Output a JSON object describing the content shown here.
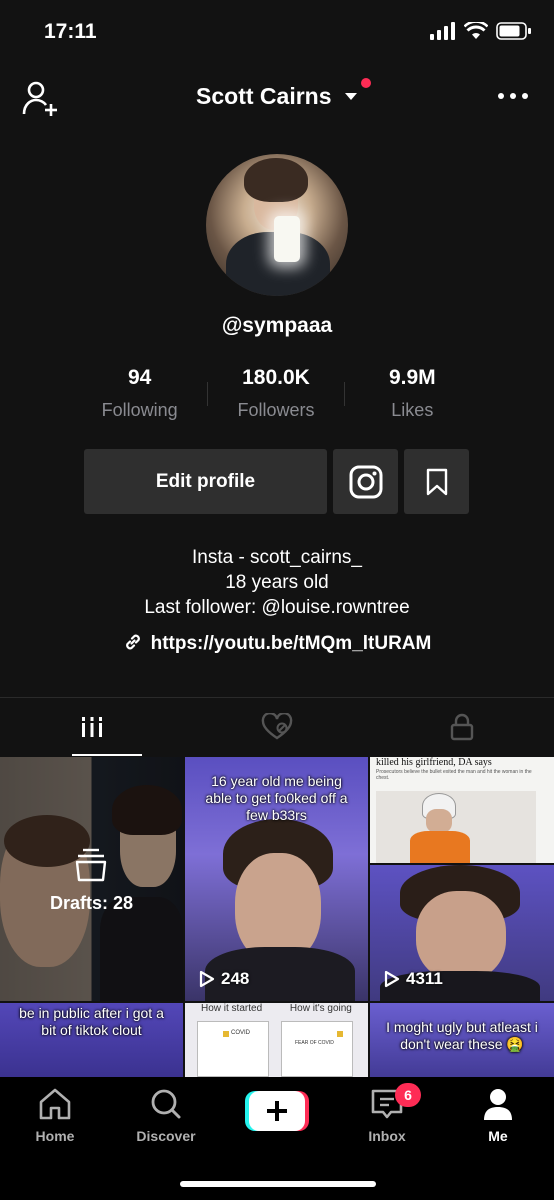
{
  "status_bar": {
    "time": "17:11"
  },
  "header": {
    "title": "Scott Cairns",
    "has_notification_dot": true
  },
  "profile": {
    "handle": "@sympaaa",
    "stats": [
      {
        "value": "94",
        "label": "Following"
      },
      {
        "value": "180.0K",
        "label": "Followers"
      },
      {
        "value": "9.9M",
        "label": "Likes"
      }
    ],
    "edit_label": "Edit profile",
    "bio_lines": [
      "Insta - scott_cairns_",
      "18 years old",
      "Last follower: @louise.rowntree"
    ],
    "link": "https://youtu.be/tMQm_ltURAM"
  },
  "tabs": [
    {
      "icon": "grid-icon",
      "active": true
    },
    {
      "icon": "liked-icon",
      "active": false
    },
    {
      "icon": "lock-icon",
      "active": false
    }
  ],
  "grid": {
    "drafts_label": "Drafts: 28",
    "videos": [
      {
        "caption": "16 year old me being able to get fo0ked off a few b33rs",
        "views": "248"
      },
      {
        "caption": "killed his girlfriend, DA says",
        "subcaption": "Prosecutors believe the bullet exited the man and hit the woman in the chest.",
        "views": ""
      },
      {
        "caption": "",
        "views": "4311"
      },
      {
        "caption": "be in public after i got a bit of tiktok clout",
        "views": ""
      },
      {
        "caption": "How it started          How it's going",
        "panel_label_1": "COVID",
        "panel_label_2": "FEAR OF COVID",
        "views": ""
      },
      {
        "caption": "I moght ugly but atleast i don't wear these 🤮",
        "views": ""
      }
    ]
  },
  "nav": {
    "home": "Home",
    "discover": "Discover",
    "inbox": "Inbox",
    "inbox_badge": "6",
    "me": "Me"
  },
  "colors": {
    "accent_red": "#fe2c55",
    "accent_cyan": "#25f4ee",
    "bg": "#121212"
  }
}
